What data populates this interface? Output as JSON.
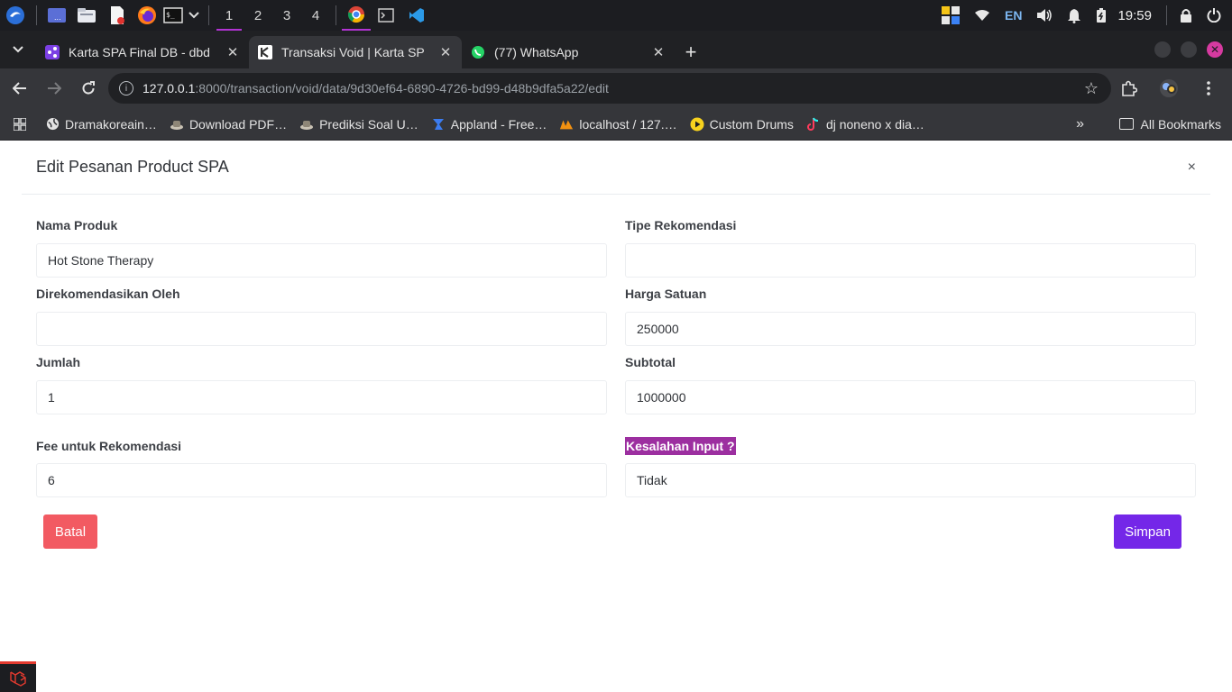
{
  "taskbar": {
    "workspaces": [
      "1",
      "2",
      "3",
      "4"
    ],
    "active_workspace": "1",
    "language": "EN",
    "clock": "19:59"
  },
  "browser": {
    "tabs": [
      {
        "title": "Karta SPA Final DB - dbd",
        "favicon": "diagram-icon"
      },
      {
        "title": "Transaksi Void | Karta SP",
        "favicon": "karta-icon",
        "active": true
      },
      {
        "title": "(77) WhatsApp",
        "favicon": "whatsapp-icon"
      }
    ],
    "url_host": "127.0.0.1",
    "url_path": ":8000/transaction/void/data/9d30ef64-6890-4726-bd99-d48b9dfa5a22/edit",
    "bookmarks": [
      "Dramakoreain…",
      "Download PDF…",
      "Prediksi Soal U…",
      "Appland - Free…",
      "localhost / 127.…",
      "Custom Drums",
      "dj noneno x dia…"
    ],
    "all_bookmarks": "All Bookmarks"
  },
  "modal": {
    "title": "Edit Pesanan Product SPA",
    "close": "×",
    "fields": {
      "nama_produk": {
        "label": "Nama Produk",
        "value": "Hot Stone Therapy"
      },
      "tipe_rekomendasi": {
        "label": "Tipe Rekomendasi",
        "value": ""
      },
      "direkomendasikan_oleh": {
        "label": "Direkomendasikan Oleh",
        "value": ""
      },
      "harga_satuan": {
        "label": "Harga Satuan",
        "value": "250000"
      },
      "jumlah": {
        "label": "Jumlah",
        "value": "1"
      },
      "subtotal": {
        "label": "Subtotal",
        "value": "1000000"
      },
      "fee_rekomendasi": {
        "label": "Fee untuk Rekomendasi",
        "value": "6"
      },
      "kesalahan_input": {
        "label": "Kesalahan Input ?",
        "value": "Tidak"
      }
    },
    "buttons": {
      "batal": "Batal",
      "simpan": "Simpan"
    }
  },
  "colors": {
    "batal": "#f25a62",
    "simpan": "#7427e8",
    "highlight": "#9c2fa0"
  }
}
